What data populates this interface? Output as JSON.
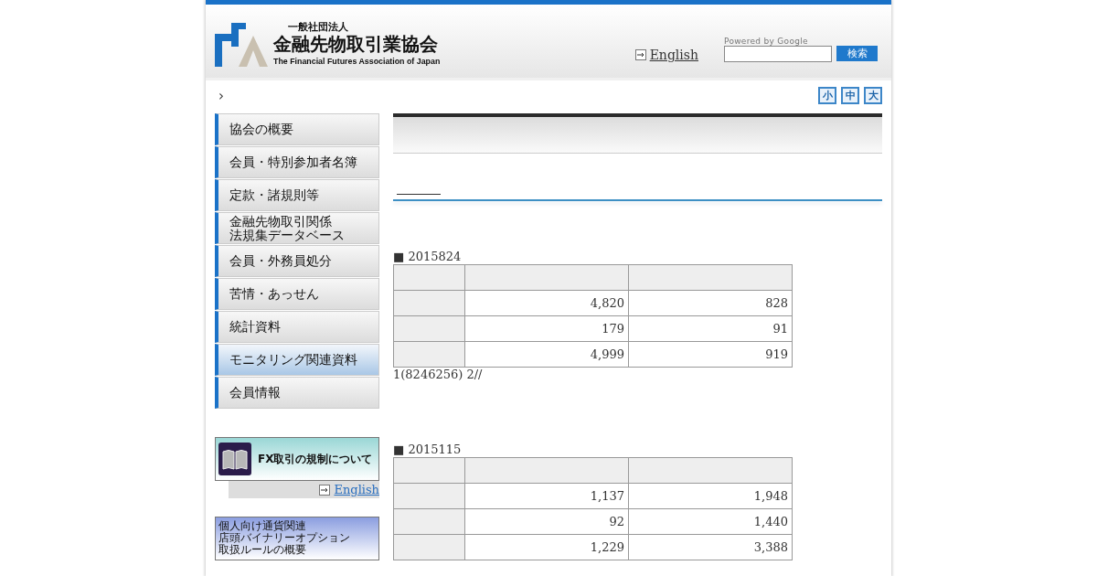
{
  "header": {
    "org_type": "一般社団法人",
    "org_name": "金融先物取引業協会",
    "org_name_en": "The Financial Futures Association of Japan",
    "english_link": "English",
    "search": {
      "powered_by": "Powered by Google",
      "button": "検索"
    }
  },
  "breadcrumb": {
    "separator": "›"
  },
  "font_size_buttons": [
    "小",
    "中",
    "大"
  ],
  "sidebar": {
    "items": [
      {
        "label": "協会の概要",
        "selected": false
      },
      {
        "label": "会員・特別参加者名簿",
        "selected": false
      },
      {
        "label": "定款・諸規則等",
        "selected": false
      },
      {
        "label": [
          "金融先物取引関係",
          "法規集データベース"
        ],
        "selected": false
      },
      {
        "label": "会員・外務員処分",
        "selected": false
      },
      {
        "label": "苦情・あっせん",
        "selected": false
      },
      {
        "label": "統計資料",
        "selected": false
      },
      {
        "label": "モニタリング関連資料",
        "selected": true
      },
      {
        "label": "会員情報",
        "selected": false
      }
    ],
    "fx_banner": {
      "label": "FX取引の規制について",
      "english_link": "English"
    },
    "binary_banner": {
      "label": [
        "個人向け通貨関連",
        "店頭バイナリーオプション",
        "取扱ルールの概要"
      ]
    }
  },
  "sections": [
    {
      "heading": "■ 2015824",
      "rows": [
        {
          "values": [
            "4,820",
            "828"
          ]
        },
        {
          "values": [
            "179",
            "91"
          ]
        },
        {
          "values": [
            "4,999",
            "919"
          ]
        }
      ],
      "note": "1(8246256) 2//"
    },
    {
      "heading": "■ 2015115",
      "rows": [
        {
          "values": [
            "1,137",
            "1,948"
          ]
        },
        {
          "values": [
            "92",
            "1,440"
          ]
        },
        {
          "values": [
            "1,229",
            "3,388"
          ]
        }
      ]
    }
  ]
}
